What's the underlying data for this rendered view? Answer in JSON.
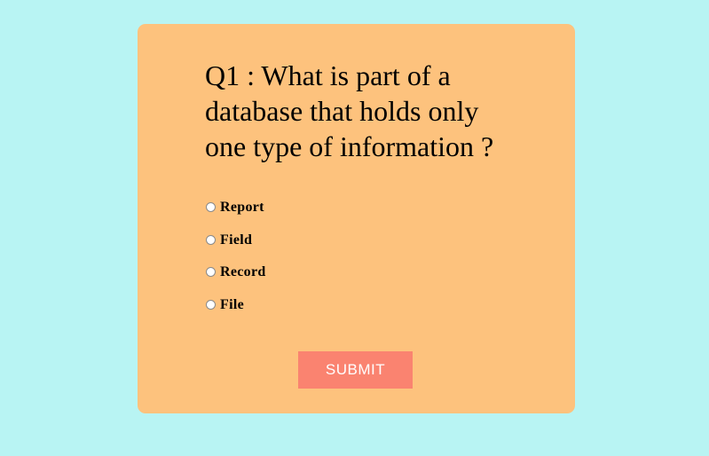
{
  "page": {
    "background_color": "#b8f4f3",
    "card_color": "#fdc27d"
  },
  "quiz": {
    "question": "Q1 : What is part of a database that holds only one type of information ?",
    "options": [
      {
        "label": "Report",
        "selected": false
      },
      {
        "label": "Field",
        "selected": false
      },
      {
        "label": "Record",
        "selected": false
      },
      {
        "label": "File",
        "selected": false
      }
    ],
    "submit_label": "SUBMIT",
    "submit_color": "#fa8370"
  }
}
